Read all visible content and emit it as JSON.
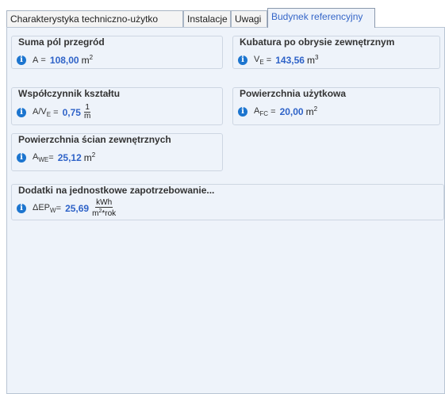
{
  "tabs": [
    {
      "label": "Charakterystyka techniczno-użytko"
    },
    {
      "label": "Instalacje"
    },
    {
      "label": "Uwagi"
    },
    {
      "label": "Budynek referencyjny"
    }
  ],
  "groups": {
    "suma": {
      "title": "Suma pól przegród",
      "symbol": "A",
      "eq": " = ",
      "value": "108,00",
      "unit": "m",
      "unit_sup": "2"
    },
    "kubatura": {
      "title": "Kubatura po obrysie zewnętrznym",
      "symbol": "V",
      "symbol_sub": "E",
      "eq": " = ",
      "value": "143,56",
      "unit": "m",
      "unit_sup": "3"
    },
    "wspolczynnik": {
      "title": "Współczynnik kształtu",
      "symbol": "A/V",
      "symbol_sub": "E",
      "eq": " = ",
      "value": "0,75",
      "frac_num": "1",
      "frac_den": "m"
    },
    "powierzchnia_uzytkowa": {
      "title": "Powierzchnia użytkowa",
      "symbol": "A",
      "symbol_sub": "FC",
      "eq": " = ",
      "value": "20,00",
      "unit": "m",
      "unit_sup": "2"
    },
    "powierzchnia_scian": {
      "title": "Powierzchnia ścian zewnętrznych",
      "symbol": "A",
      "symbol_sub": "WE",
      "eq": "= ",
      "value": "25,12",
      "unit": "m",
      "unit_sup": "2"
    },
    "dodatki": {
      "title": "Dodatki na jednostkowe zapotrzebowanie...",
      "symbol": "ΔEP",
      "symbol_sub": "W",
      "eq": "= ",
      "value": "25,69",
      "frac_num": "kWh",
      "frac_den_base": "m",
      "frac_den_sup": "2",
      "frac_den_rest": "*rok"
    }
  },
  "icons": {
    "info": "i"
  }
}
